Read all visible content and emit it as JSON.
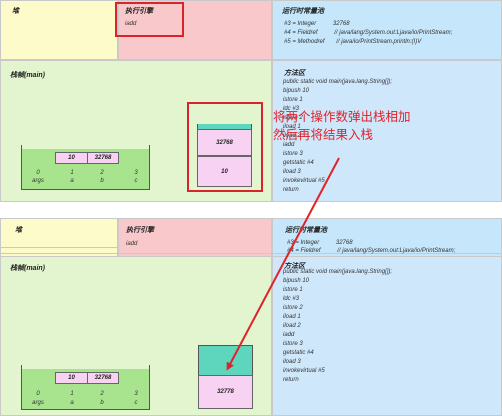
{
  "panels": {
    "heap_title": "堆",
    "engine_title": "执行引擎",
    "pool_title": "运行时常量池",
    "stack_title": "栈帧(main)",
    "method_title": "方法区"
  },
  "engine": {
    "top_instruction": "iadd",
    "bottom_instruction": "iadd"
  },
  "constant_pool": [
    "#3 = Integer          32768",
    "#4 = Fieldref          // java/lang/System.out:Ljava/io/PrintStream;",
    "#5 = Methodref       // java/io/PrintStream.println:(I)V"
  ],
  "method_code_top": [
    "public static void main(java.lang.String[]);",
    "bipush 10",
    "istore 1",
    "ldc #3",
    "istore 2",
    "iload 1",
    "iload 2",
    "iadd",
    "istore 3",
    "getstatic #4",
    "iload 3",
    "invokevirtual #5",
    "return"
  ],
  "method_code_bottom": [
    "public static void main(java.lang.String[]);",
    "bipush 10",
    "istore 1",
    "ldc #3",
    "istore 2",
    "iload 1",
    "iload 2",
    "iadd",
    "istore 3",
    "getstatic #4",
    "iload 3",
    "invokevirtual #5",
    "return"
  ],
  "locals": {
    "values": [
      "",
      "10",
      "32768",
      ""
    ],
    "indices": [
      "0",
      "1",
      "2",
      "3"
    ],
    "names": [
      "args",
      "a",
      "b",
      "c"
    ]
  },
  "operand_stack_top": [
    "32768",
    "10"
  ],
  "operand_stack_bottom": [
    "32778"
  ],
  "annotation": "将两个操作数弹出栈相加\n然后再将结果入栈",
  "colors": {
    "annotation": "#e0232a",
    "highlight_box": "#d9232d"
  }
}
